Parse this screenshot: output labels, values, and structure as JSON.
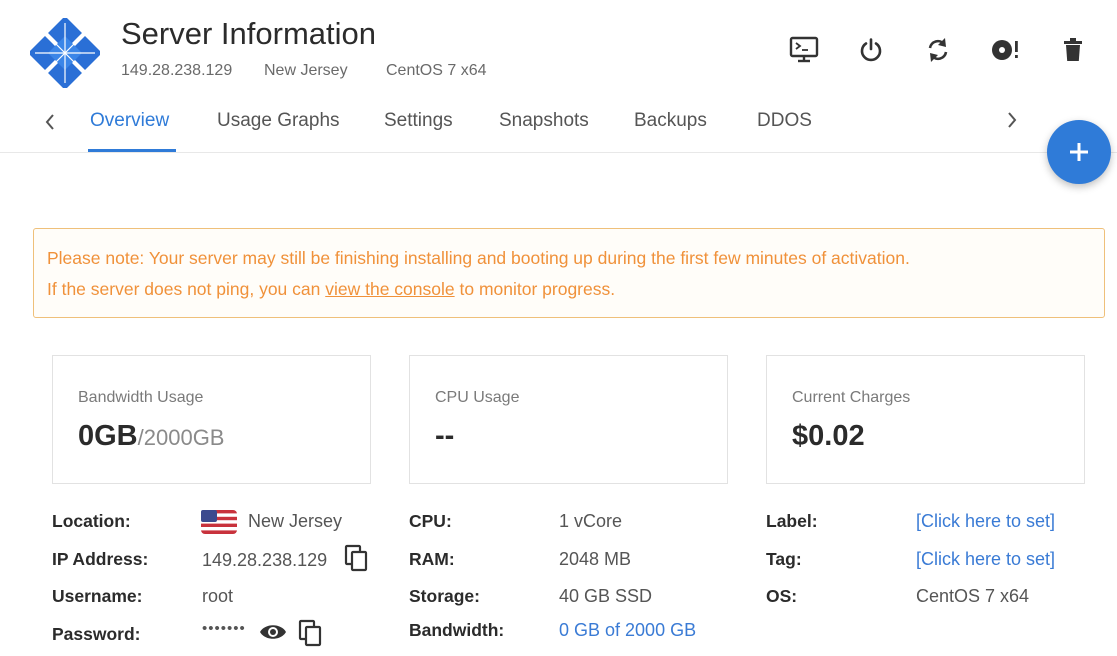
{
  "header": {
    "title": "Server Information",
    "ip": "149.28.238.129",
    "location": "New Jersey",
    "os": "CentOS 7 x64"
  },
  "toolbar": {
    "icons": [
      "console-icon",
      "power-icon",
      "restart-icon",
      "reinstall-icon",
      "delete-icon"
    ]
  },
  "tabs": [
    {
      "label": "Overview",
      "active": true
    },
    {
      "label": "Usage Graphs"
    },
    {
      "label": "Settings"
    },
    {
      "label": "Snapshots"
    },
    {
      "label": "Backups"
    },
    {
      "label": "DDOS"
    }
  ],
  "notice": {
    "line1": "Please note: Your server may still be finishing installing and booting up during the first few minutes of activation.",
    "line2_pre": "If the server does not ping, you can ",
    "line2_link": "view the console",
    "line2_post": " to monitor progress."
  },
  "cards": {
    "bandwidth": {
      "label": "Bandwidth Usage",
      "value": "0GB",
      "sub": "/2000GB"
    },
    "cpu": {
      "label": "CPU Usage",
      "value": "--"
    },
    "charges": {
      "label": "Current Charges",
      "value": "$0.02"
    }
  },
  "details": {
    "location": {
      "label": "Location:",
      "value": "New Jersey"
    },
    "ip": {
      "label": "IP Address:",
      "value": "149.28.238.129"
    },
    "username": {
      "label": "Username:",
      "value": "root"
    },
    "password": {
      "label": "Password:",
      "value": "•••••••"
    },
    "cpu": {
      "label": "CPU:",
      "value": "1 vCore"
    },
    "ram": {
      "label": "RAM:",
      "value": "2048 MB"
    },
    "storage": {
      "label": "Storage:",
      "value": "40 GB SSD"
    },
    "bandwidth": {
      "label": "Bandwidth:",
      "value": "0 GB of 2000 GB"
    },
    "label": {
      "label": "Label:",
      "value": "[Click here to set]"
    },
    "tag": {
      "label": "Tag:",
      "value": "[Click here to set]"
    },
    "os": {
      "label": "OS:",
      "value": "CentOS 7 x64"
    }
  },
  "colors": {
    "accent": "#2f7bd8",
    "notice": "#f0913a",
    "link": "#3a7bd5"
  }
}
